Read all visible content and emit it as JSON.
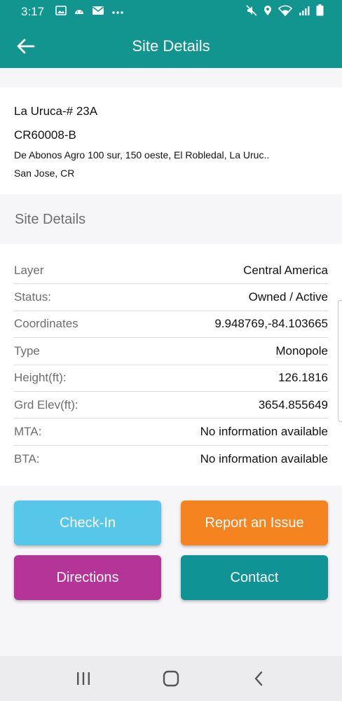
{
  "status_bar": {
    "time": "3:17",
    "left_icons": [
      "image-icon",
      "android-icon",
      "mail-icon",
      "more-icon"
    ],
    "right_icons": [
      "mute-icon",
      "location-icon",
      "wifi-icon",
      "signal-icon",
      "battery-icon"
    ]
  },
  "app_bar": {
    "title": "Site Details",
    "back_icon": "back-arrow-icon"
  },
  "site": {
    "name": "La Uruca-# 23A",
    "code": "CR60008-B",
    "address_line1": "De Abonos Agro 100 sur, 150 oeste, El Robledal, La Uruc..",
    "address_line2": "San Jose, CR"
  },
  "section": {
    "title": "Site Details"
  },
  "details": [
    {
      "label": "Layer",
      "value": "Central America"
    },
    {
      "label": "Status:",
      "value": "Owned / Active"
    },
    {
      "label": "Coordinates",
      "value": "9.948769,-84.103665"
    },
    {
      "label": "Type",
      "value": "Monopole"
    },
    {
      "label": "Height(ft):",
      "value": "126.1816"
    },
    {
      "label": "Grd Elev(ft):",
      "value": "3654.855649"
    },
    {
      "label": "MTA:",
      "value": "No information available"
    },
    {
      "label": "BTA:",
      "value": "No information available"
    }
  ],
  "actions": {
    "checkin": "Check-In",
    "report": "Report an Issue",
    "directions": "Directions",
    "contact": "Contact"
  },
  "colors": {
    "primary": "#13958f",
    "checkin": "#56c7e8",
    "report": "#f58420",
    "directions": "#b43497",
    "contact": "#109394"
  },
  "nav_bar": {
    "icons": [
      "recent-apps-icon",
      "home-icon",
      "back-icon"
    ]
  }
}
